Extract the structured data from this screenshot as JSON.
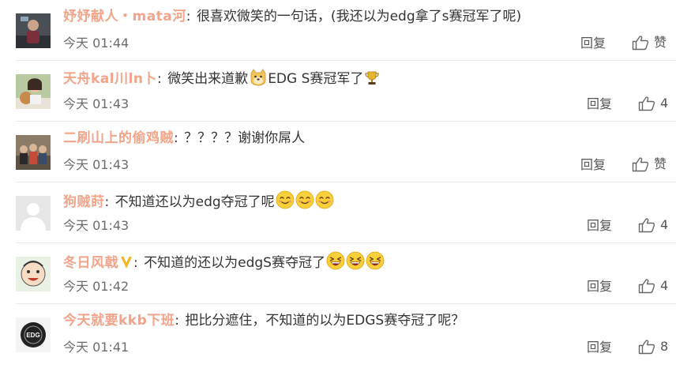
{
  "comments": [
    {
      "username": "妤妤献人・mata河",
      "text": "很喜欢微笑的一句话，(我还以为edg拿了s赛冠军了呢)",
      "time": "今天 01:44",
      "reply": "回复",
      "like_label": "赞",
      "avatar_icon": "avatar-dark-figure"
    },
    {
      "username": "天舟kal川ln卜",
      "text_before": "微笑出来道歉",
      "emoji_mid": "doge-emoji",
      "text_after": "EDG S赛冠军了",
      "emoji_end": "trophy-emoji",
      "time": "今天 01:43",
      "reply": "回复",
      "like_label": "4",
      "avatar_icon": "avatar-girl-with-dog"
    },
    {
      "username": "二刷山上的偷鸡贼",
      "text": "？？？？谢谢你屌人",
      "time": "今天 01:43",
      "reply": "回复",
      "like_label": "赞",
      "avatar_icon": "avatar-group-photo"
    },
    {
      "username": "狗贼莳",
      "text": "不知道还以为edg夺冠了呢",
      "emoji_end": "smile-emoji",
      "emoji_count": 3,
      "time": "今天 01:43",
      "reply": "回复",
      "like_label": "4",
      "avatar_icon": "avatar-default"
    },
    {
      "username": "冬日风戟",
      "badge": "vip-v-icon",
      "text": "不知道的还以为edgS赛夺冠了",
      "emoji_end": "laugh-emoji",
      "emoji_count": 3,
      "time": "今天 01:42",
      "reply": "回复",
      "like_label": "4",
      "avatar_icon": "avatar-cartoon-face"
    },
    {
      "username": "今天就要kkb下班",
      "text": "把比分遮住，不知道的以为EDGS赛夺冠了呢？",
      "time": "今天 01:41",
      "reply": "回复",
      "like_label": "8",
      "avatar_icon": "avatar-edg-logo",
      "avatar_text": "EDG"
    }
  ],
  "colors": {
    "username": "#f1a48a",
    "text": "#333333",
    "meta": "#6b6b6b",
    "divider": "#e8e8e8"
  }
}
